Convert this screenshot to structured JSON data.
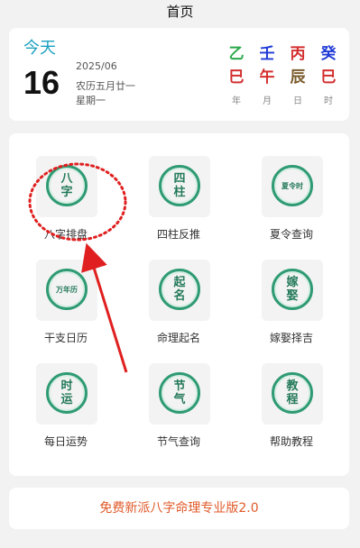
{
  "header": {
    "title": "首页"
  },
  "date": {
    "today_label": "今天",
    "day": "16",
    "year_month": "2025/06",
    "lunar": "农历五月廿一",
    "weekday": "星期一"
  },
  "pillars": [
    {
      "stem": "乙",
      "branch": "巳",
      "label": "年",
      "stem_color": "#2aa84a",
      "branch_color": "#d32f2f"
    },
    {
      "stem": "壬",
      "branch": "午",
      "label": "月",
      "stem_color": "#1f3ad6",
      "branch_color": "#d32f2f"
    },
    {
      "stem": "丙",
      "branch": "辰",
      "label": "日",
      "stem_color": "#d32f2f",
      "branch_color": "#7a5a2b"
    },
    {
      "stem": "癸",
      "branch": "巳",
      "label": "时",
      "stem_color": "#1f3ad6",
      "branch_color": "#d32f2f"
    }
  ],
  "tools": [
    {
      "seal": [
        "八",
        "字"
      ],
      "label": "八字排盘"
    },
    {
      "seal": [
        "四",
        "柱"
      ],
      "label": "四柱反推"
    },
    {
      "seal": [
        "夏令时"
      ],
      "label": "夏令查询"
    },
    {
      "seal": [
        "万年历"
      ],
      "label": "干支日历"
    },
    {
      "seal": [
        "起",
        "名"
      ],
      "label": "命理起名"
    },
    {
      "seal": [
        "嫁",
        "娶"
      ],
      "label": "嫁娶择吉"
    },
    {
      "seal": [
        "时",
        "运"
      ],
      "label": "每日运势"
    },
    {
      "seal": [
        "节",
        "气"
      ],
      "label": "节气查询"
    },
    {
      "seal": [
        "教",
        "程"
      ],
      "label": "帮助教程"
    }
  ],
  "banner": {
    "text": "免费新派八字命理专业版2.0"
  },
  "colors": {
    "accent_today": "#1ca0c0",
    "seal_green": "#2f9b73",
    "banner_text": "#e05a2a",
    "annotation_red": "#e02020"
  }
}
